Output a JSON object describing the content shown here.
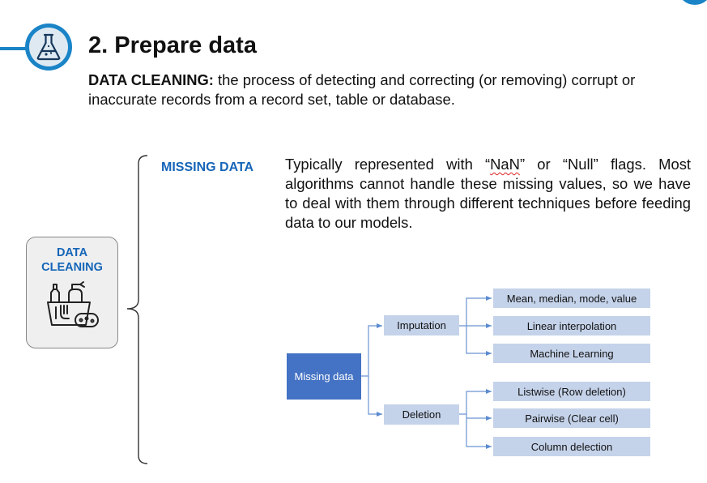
{
  "header": {
    "title": "2. Prepare data",
    "definition_term": "DATA CLEANING:",
    "definition_text": " the process of detecting and correcting (or removing) corrupt or inaccurate records from a record set, table or database.",
    "badge_icon": "flask-icon",
    "accent_color": "#1a84c7"
  },
  "category_box": {
    "label_line1": "DATA",
    "label_line2": "CLEANING",
    "icon": "cleaning-supplies-icon"
  },
  "missing_data": {
    "label": "MISSING DATA",
    "desc_part1": "Typically represented with “",
    "desc_nan": "NaN",
    "desc_part2": "” or “Null” flags. Most algorithms cannot handle these missing values, so we have to deal with them through different techniques before feeding data to our models.",
    "label_color": "#1565b8"
  },
  "diagram": {
    "root": "Missing data",
    "imputation": "Imputation",
    "deletion": "Deletion",
    "imputation_children": [
      "Mean, median, mode, value",
      "Linear interpolation",
      "Machine Learning"
    ],
    "deletion_children": [
      "Listwise (Row deletion)",
      "Pairwise (Clear cell)",
      "Column delection"
    ],
    "root_color": "#4472c4",
    "node_color": "#c5d3ea"
  }
}
